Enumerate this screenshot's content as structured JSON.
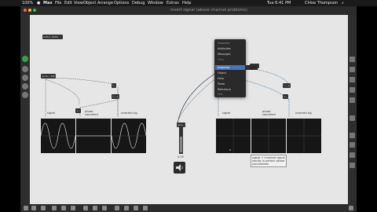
{
  "menubar": {
    "zoom": "100%",
    "app_name": "Max",
    "items": [
      "File",
      "Edit",
      "View",
      "Object",
      "Arrange",
      "Options",
      "Debug",
      "Window",
      "Extras",
      "Help"
    ],
    "clock": "Tue 6:41 PM",
    "user": "Chloe Thompson"
  },
  "window": {
    "title": "invert signal (above channel problems)"
  },
  "patch": {
    "toggle_label": "button (DSP)",
    "phasor_label": "cycle~ 440",
    "obj_left_a": "*~",
    "obj_left_b": "*~ -1",
    "obj_left_c": "+~",
    "obj_mid": "gain~",
    "obj_right_a": "*~ -1",
    "obj_right_b": "+~",
    "obj_right_c": "cycle~",
    "comment_signal_left": "signal",
    "comment_phase_left": "phase cancelled",
    "comment_inverted_left": "inverted sig",
    "comment_signal_right": "signal",
    "comment_phase_right": "phase cancelled",
    "comment_inverted_right": "inverted sig",
    "comment_note": "signal + inverted signal results in perfect phase cancellation",
    "level_value": "0.05"
  },
  "context_menu": {
    "header": "Inspector",
    "items": [
      "Attributes",
      "Messages",
      "Help",
      "Inspector",
      "Object",
      "Help",
      "Paste",
      "Reference",
      "Info"
    ],
    "highlighted_index": 3,
    "submenu_label": "…"
  },
  "colors": {
    "canvas": "#e6e6e6",
    "scope_bg": "#161616",
    "wave": "#d9d9d9",
    "accent": "#4a74b8"
  }
}
